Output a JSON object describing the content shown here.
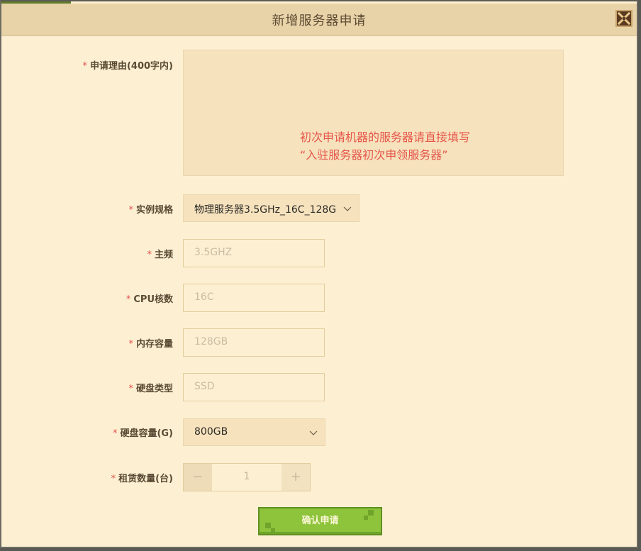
{
  "dialog": {
    "title": "新增服务器申请",
    "close_icon": "close-icon"
  },
  "form": {
    "required_mark": "*",
    "reason": {
      "label": "申请理由(400字内)",
      "hint_line1": "初次申请机器的服务器请直接填写",
      "hint_line2": "“入驻服务器初次申领服务器”"
    },
    "instance_spec": {
      "label": "实例规格",
      "value": "物理服务器3.5GHz_16C_128G"
    },
    "frequency": {
      "label": "主频",
      "placeholder": "3.5GHZ"
    },
    "cpu_cores": {
      "label": "CPU核数",
      "placeholder": "16C"
    },
    "memory": {
      "label": "内存容量",
      "placeholder": "128GB"
    },
    "disk_type": {
      "label": "硬盘类型",
      "placeholder": "SSD"
    },
    "disk_capacity": {
      "label": "硬盘容量(G)",
      "value": "800GB"
    },
    "quantity": {
      "label": "租赁数量(台)",
      "value": "1",
      "minus": "−",
      "plus": "+"
    },
    "submit_label": "确认申请"
  },
  "colors": {
    "accent": "#8ec43c",
    "required": "#e0504a",
    "hint": "#e5564a",
    "background": "#fdf0d2"
  }
}
